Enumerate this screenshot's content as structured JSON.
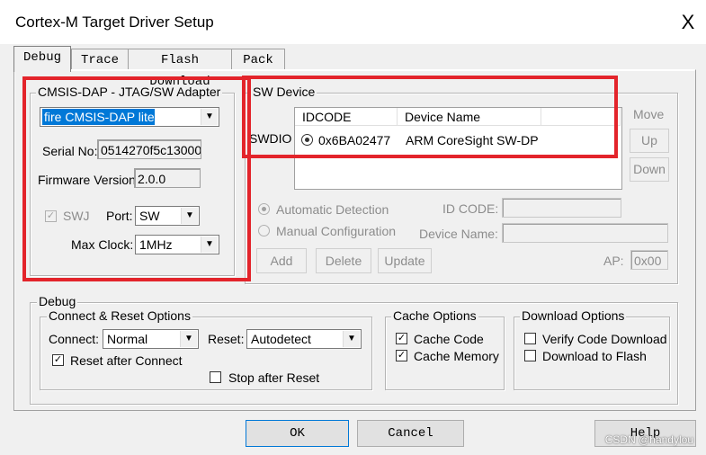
{
  "window": {
    "title": "Cortex-M Target Driver Setup",
    "close_glyph": "X"
  },
  "tabs": [
    {
      "label": "Debug",
      "active": true
    },
    {
      "label": "Trace"
    },
    {
      "label": "Flash Download"
    },
    {
      "label": "Pack"
    }
  ],
  "adapter": {
    "group_label": "CMSIS-DAP - JTAG/SW Adapter",
    "selected": "fire CMSIS-DAP lite",
    "serial_label": "Serial No:",
    "serial_value": "0514270f5c13000",
    "firmware_label": "Firmware Version:",
    "firmware_value": "2.0.0",
    "swj_label": "SWJ",
    "swj_checked": true,
    "port_label": "Port:",
    "port_value": "SW",
    "clock_label": "Max Clock:",
    "clock_value": "1MHz"
  },
  "sw_device": {
    "group_label": "SW Device",
    "row_label": "SWDIO",
    "columns": [
      "IDCODE",
      "Device Name"
    ],
    "rows": [
      {
        "idcode": "0x6BA02477",
        "name": "ARM CoreSight SW-DP"
      }
    ],
    "move_label": "Move",
    "up_label": "Up",
    "down_label": "Down",
    "auto_label": "Automatic Detection",
    "manual_label": "Manual Configuration",
    "idcode_label": "ID CODE:",
    "devname_label": "Device Name:",
    "add_label": "Add",
    "delete_label": "Delete",
    "update_label": "Update",
    "ap_label": "AP:",
    "ap_value": "0x00"
  },
  "debug": {
    "group_label": "Debug",
    "connect_group": "Connect & Reset Options",
    "connect_label": "Connect:",
    "connect_value": "Normal",
    "reset_label": "Reset:",
    "reset_value": "Autodetect",
    "reset_after_connect": "Reset after Connect",
    "stop_after_reset": "Stop after Reset",
    "cache_group": "Cache Options",
    "cache_code": "Cache Code",
    "cache_memory": "Cache Memory",
    "download_group": "Download Options",
    "verify_code": "Verify Code Download",
    "download_flash": "Download to Flash"
  },
  "buttons": {
    "ok": "OK",
    "cancel": "Cancel",
    "help": "Help"
  },
  "watermark": "CSDN @handylou",
  "colors": {
    "annotation_red": "#e3242b",
    "selection_blue": "#0078d7"
  }
}
